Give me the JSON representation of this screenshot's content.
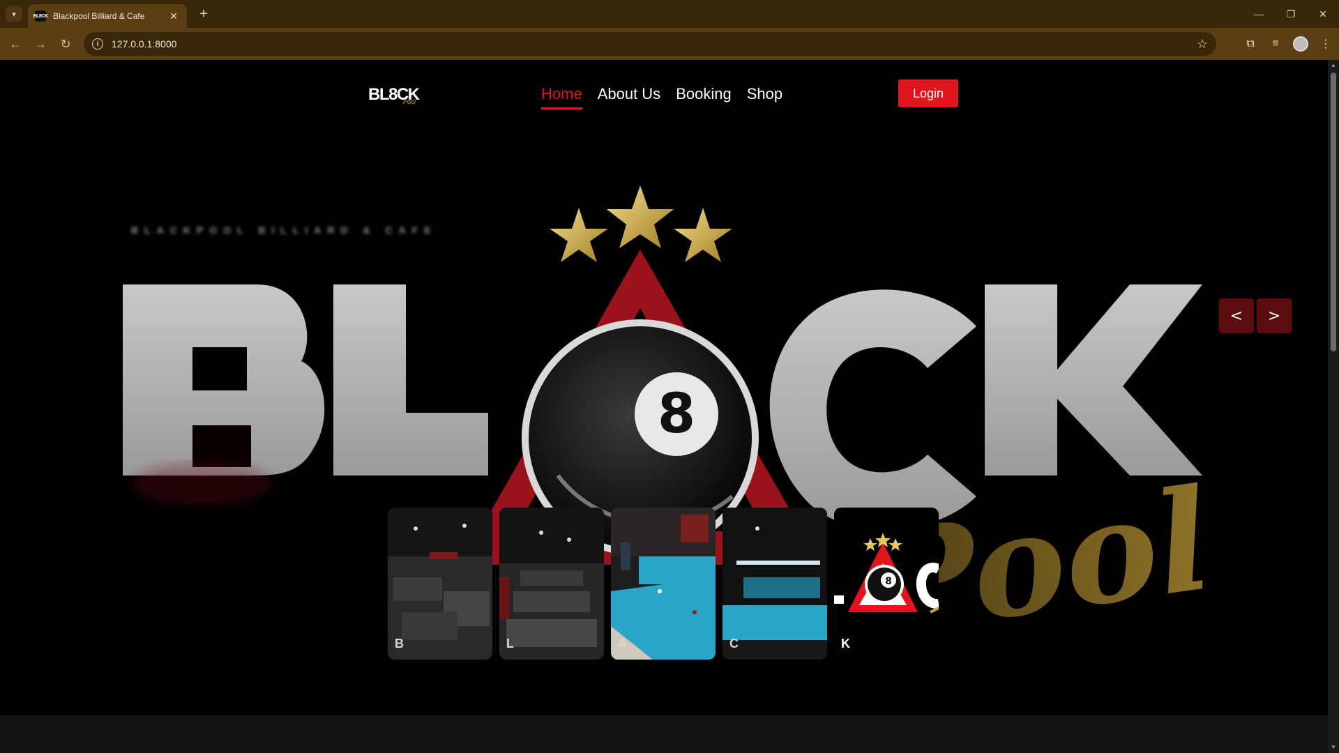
{
  "browser": {
    "tab_title": "Blackpool Billiard & Cafe",
    "favicon_text": "BL8CK",
    "url": "127.0.0.1:8000",
    "new_tab_glyph": "+",
    "close_glyph": "✕",
    "minimize_glyph": "—",
    "restore_glyph": "❐",
    "window_close_glyph": "✕"
  },
  "site": {
    "logo_text": "BL8CK",
    "logo_sub": "Pool",
    "nav": [
      {
        "label": "Home",
        "active": true
      },
      {
        "label": "About Us",
        "active": false
      },
      {
        "label": "Booking",
        "active": false
      },
      {
        "label": "Shop",
        "active": false
      }
    ],
    "login_label": "Login"
  },
  "hero": {
    "tagline": "BLACKPOOL BILLIARD & CAFE",
    "title_letters": [
      "B",
      "L",
      "8",
      "C",
      "K"
    ],
    "script_word": "Pool",
    "ball_number": "8",
    "prev_glyph": "<",
    "next_glyph": ">",
    "thumbnails": [
      {
        "letter": "B",
        "kind": "photo"
      },
      {
        "letter": "L",
        "kind": "photo"
      },
      {
        "letter": "A",
        "kind": "photo"
      },
      {
        "letter": "C",
        "kind": "photo"
      },
      {
        "letter": "K",
        "kind": "logo",
        "active": true
      }
    ]
  },
  "colors": {
    "accent_red": "#e2141d",
    "gold": "#c9a43c",
    "chrome_dark": "#3a2608",
    "chrome_mid": "#5a3e14",
    "pool_felt": "#2aa7c8"
  }
}
